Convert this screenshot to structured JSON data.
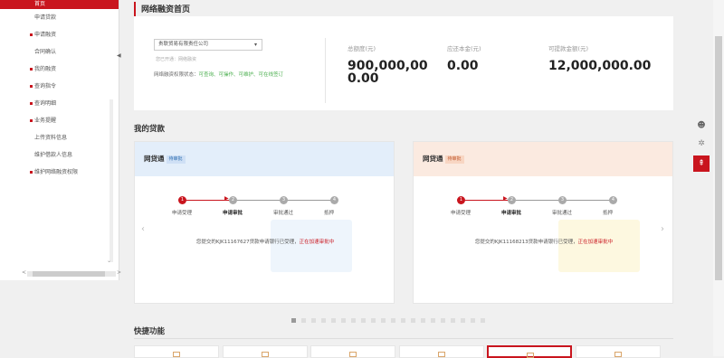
{
  "sidebar": {
    "active_label": "首页",
    "items": [
      {
        "label": "申请贷款",
        "marker": false
      },
      {
        "label": "申请融资",
        "marker": true
      },
      {
        "label": "合同确认",
        "marker": false
      },
      {
        "label": "我的融资",
        "marker": true
      },
      {
        "label": "查询指令",
        "marker": true
      },
      {
        "label": "查询明细",
        "marker": true
      },
      {
        "label": "业务提醒",
        "marker": true
      },
      {
        "label": "上传资料信息",
        "marker": false
      },
      {
        "label": "维护借款人信息",
        "marker": false
      },
      {
        "label": "维护网络融资权限",
        "marker": true
      }
    ]
  },
  "page": {
    "title": "网络融资首页"
  },
  "finance": {
    "select_value": "贵联贸易有限责任公司",
    "select_hint": "您已开通：网络融资",
    "status_label": "网络融资权限状态：",
    "status_value": "可查询、可操作、可维护、可在线签订",
    "stats": [
      {
        "label": "总额度(元)",
        "value": "900,000,000.00"
      },
      {
        "label": "应还本金(元)",
        "value": "0.00"
      },
      {
        "label": "可提款金额(元)",
        "value": "12,000,000.00"
      }
    ]
  },
  "loans": {
    "title": "我的贷款",
    "cards": [
      {
        "product": "网贷通",
        "tag": "待审批",
        "steps": [
          "申请受理",
          "申请审批",
          "审批通过",
          "抵押"
        ],
        "message_prefix": "您提交的KJK11167627贷款申请银行已受理，",
        "message_highlight": "正在加速审批中"
      },
      {
        "product": "网贷通",
        "tag": "待审批",
        "steps": [
          "申请受理",
          "申请审批",
          "审批通过",
          "抵押"
        ],
        "message_prefix": "您提交的KJK11168213贷款申请银行已受理，",
        "message_highlight": "正在加速审批中"
      }
    ],
    "page_dots": 20,
    "active_dot": 0
  },
  "quick": {
    "title": "快捷功能",
    "cell_count": 6,
    "highlighted_index": 4
  },
  "colors": {
    "brand_red": "#c9151e",
    "card1_head": "#e3eefa",
    "card2_head": "#fbeae0",
    "ok_green": "#4caf50"
  }
}
